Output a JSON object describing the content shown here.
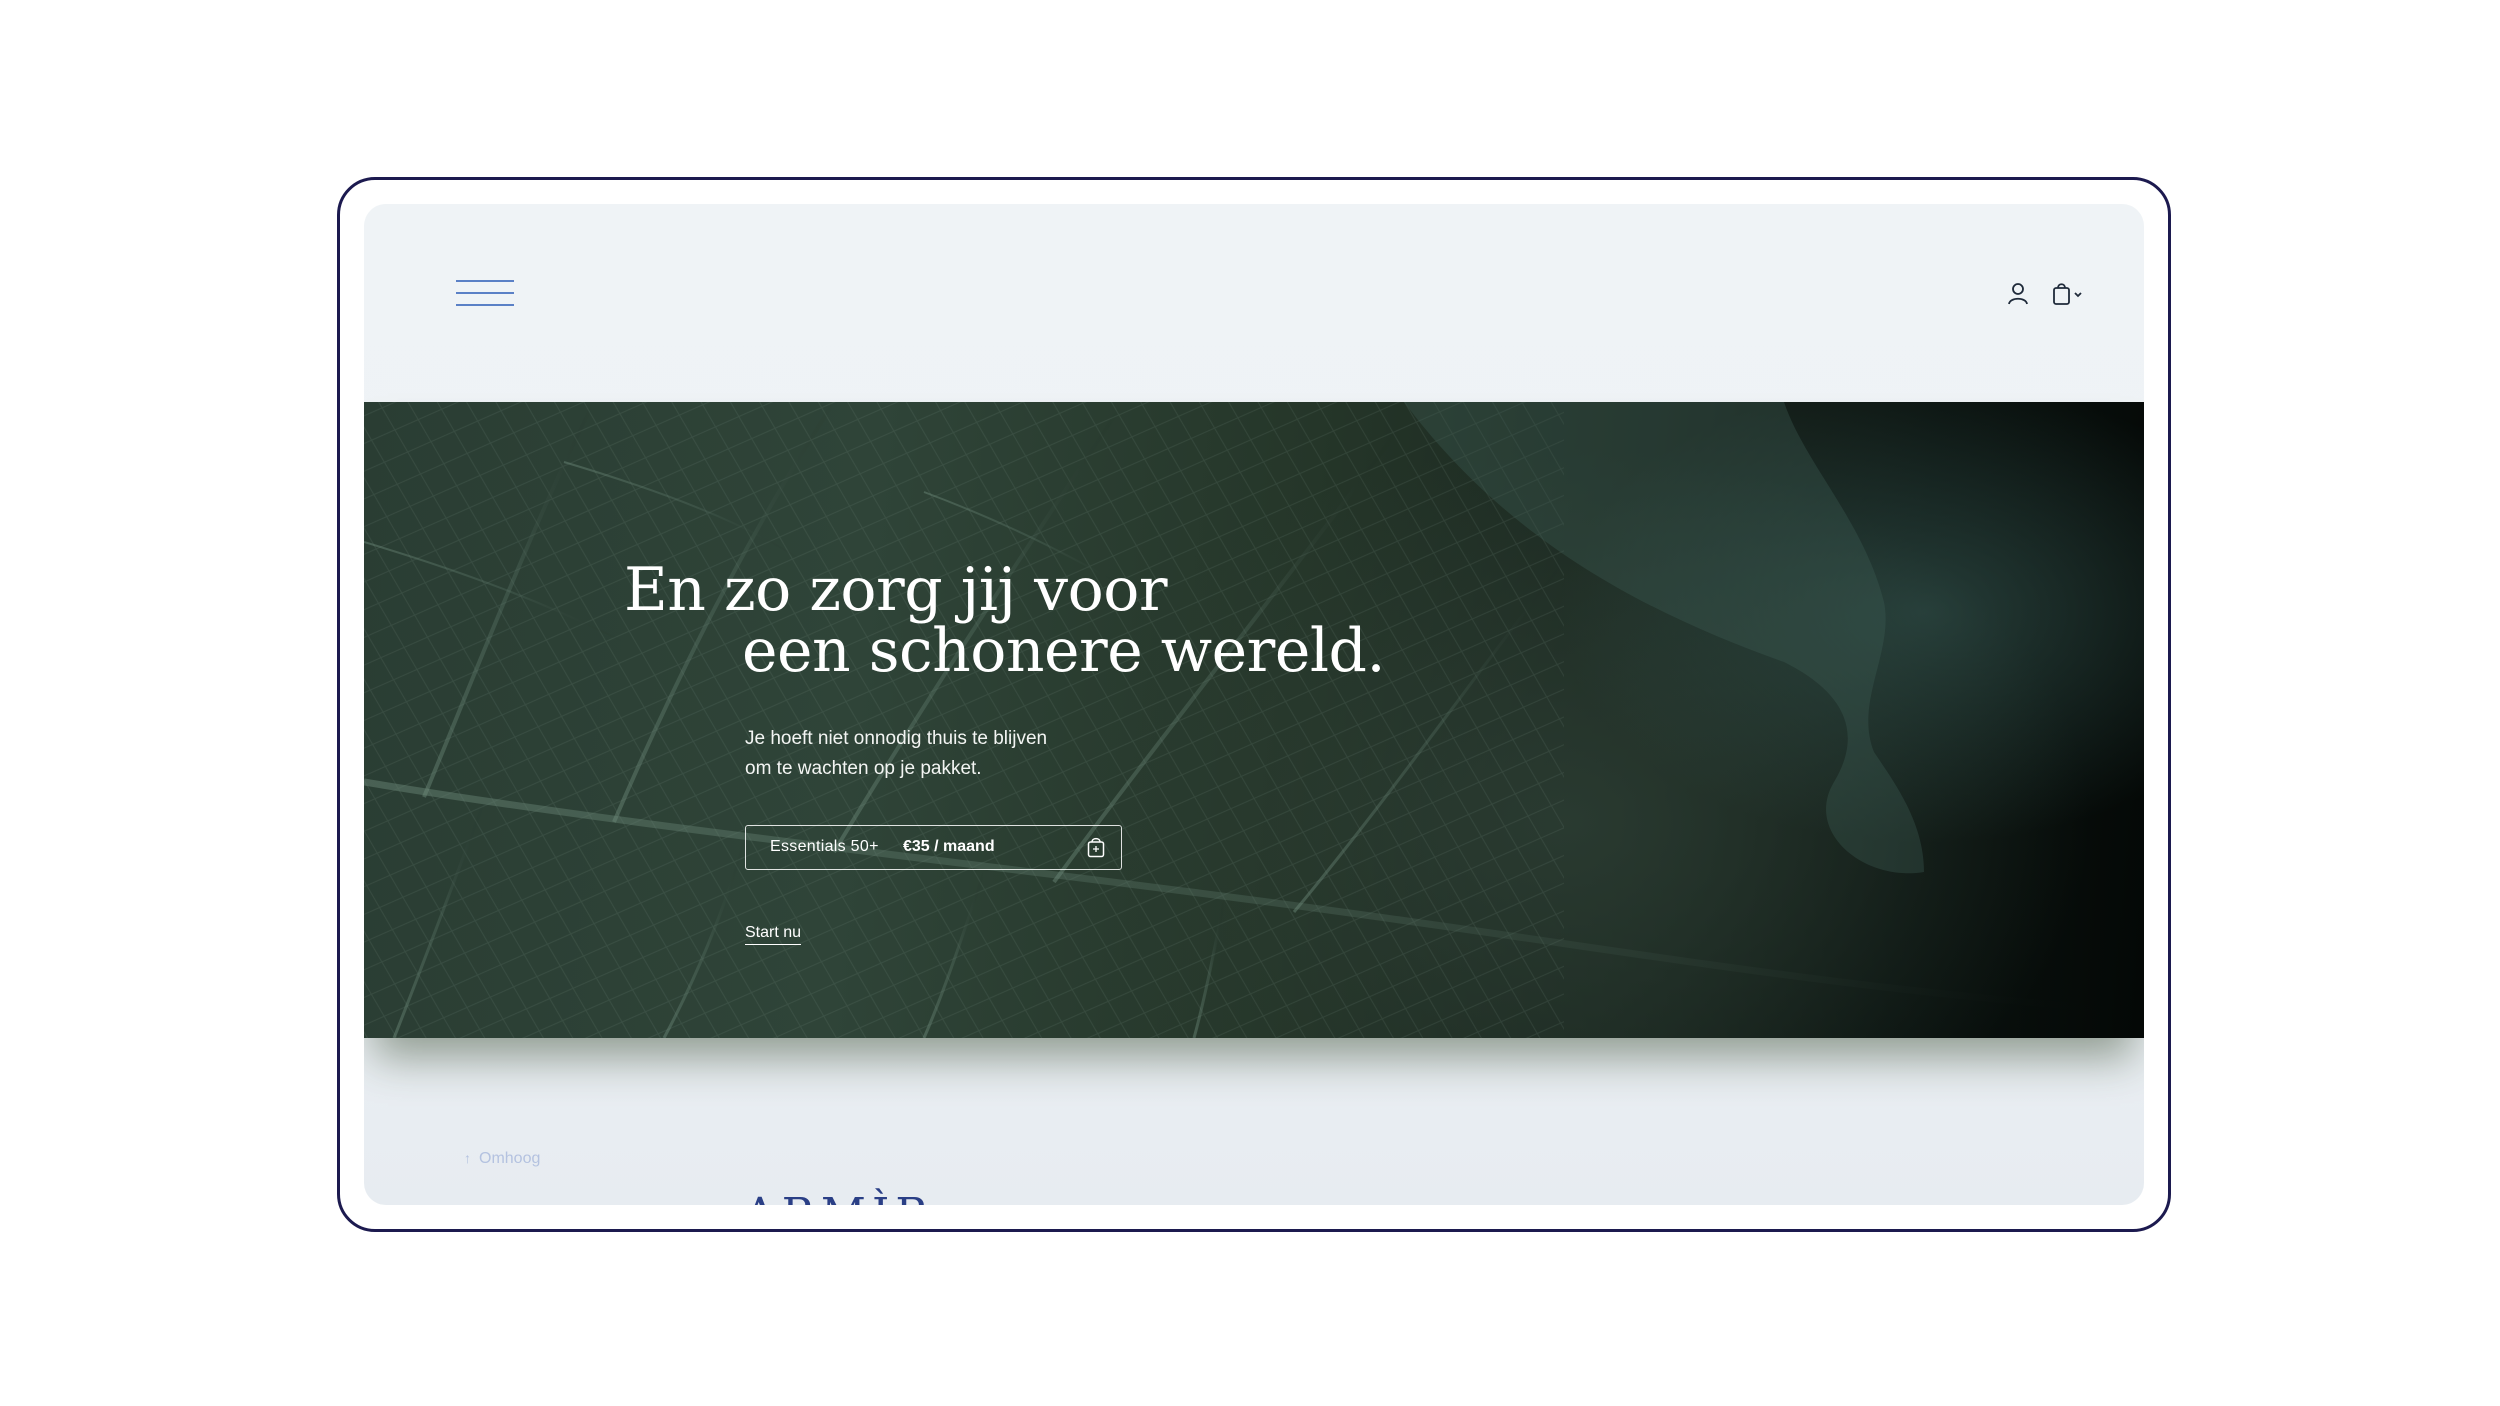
{
  "header": {
    "menu_icon": "hamburger-menu-icon",
    "account_icon": "user-icon",
    "cart_icon": "shopping-bag-icon"
  },
  "hero": {
    "title_line1": "En zo zorg jij voor",
    "title_line2": "een schonere wereld.",
    "subtitle_line1": "Je hoeft niet onnodig thuis te blijven",
    "subtitle_line2": "om te wachten op je pakket.",
    "product": {
      "name": "Essentials 50+",
      "price": "€35 / maand",
      "icon": "bag-icon"
    },
    "cta_label": "Start nu"
  },
  "footer": {
    "back_to_top_label": "Omhoog",
    "logo_text": "ARMÌR"
  },
  "colors": {
    "frame": "#1c1a4f",
    "screen_bg": "#eff3f6",
    "menu_lines": "#5a80c6",
    "hero_dark": "#2a3d33",
    "back_to_top": "#b4c2e0",
    "logo": "#2a3f86"
  }
}
